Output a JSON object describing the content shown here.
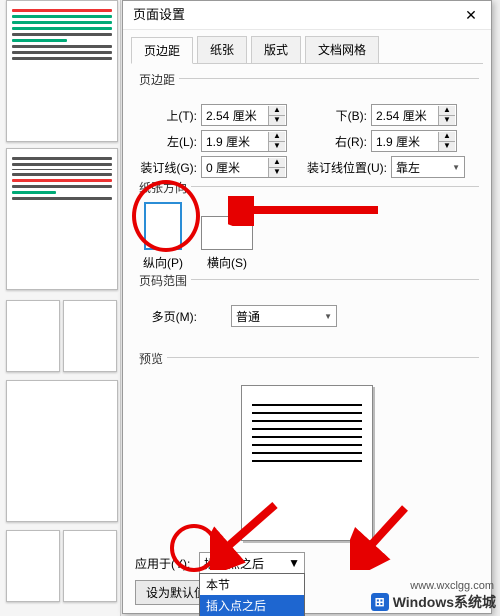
{
  "dialog": {
    "title": "页面设置",
    "close": "✕"
  },
  "tabs": {
    "t1": "页边距",
    "t2": "纸张",
    "t3": "版式",
    "t4": "文档网格"
  },
  "margins": {
    "section": "页边距",
    "top_lbl": "上(T):",
    "top_val": "2.54 厘米",
    "bottom_lbl": "下(B):",
    "bottom_val": "2.54 厘米",
    "left_lbl": "左(L):",
    "left_val": "1.9 厘米",
    "right_lbl": "右(R):",
    "right_val": "1.9 厘米",
    "gutter_lbl": "装订线(G):",
    "gutter_val": "0 厘米",
    "gutter_pos_lbl": "装订线位置(U):",
    "gutter_pos_val": "靠左"
  },
  "orientation": {
    "section": "纸张方向",
    "portrait": "纵向(P)",
    "landscape": "横向(S)"
  },
  "pages": {
    "section": "页码范围",
    "multi_lbl": "多页(M):",
    "multi_val": "普通"
  },
  "preview": {
    "section": "预览"
  },
  "apply": {
    "label": "应用于(Y):",
    "selected": "插入点之后",
    "opt1": "本节",
    "opt2": "插入点之后"
  },
  "default_btn": "设为默认值",
  "spin": {
    "up": "▲",
    "down": "▼",
    "drop": "▼"
  },
  "watermark": {
    "text": "Windows系统城",
    "url": "www.wxclgg.com"
  }
}
